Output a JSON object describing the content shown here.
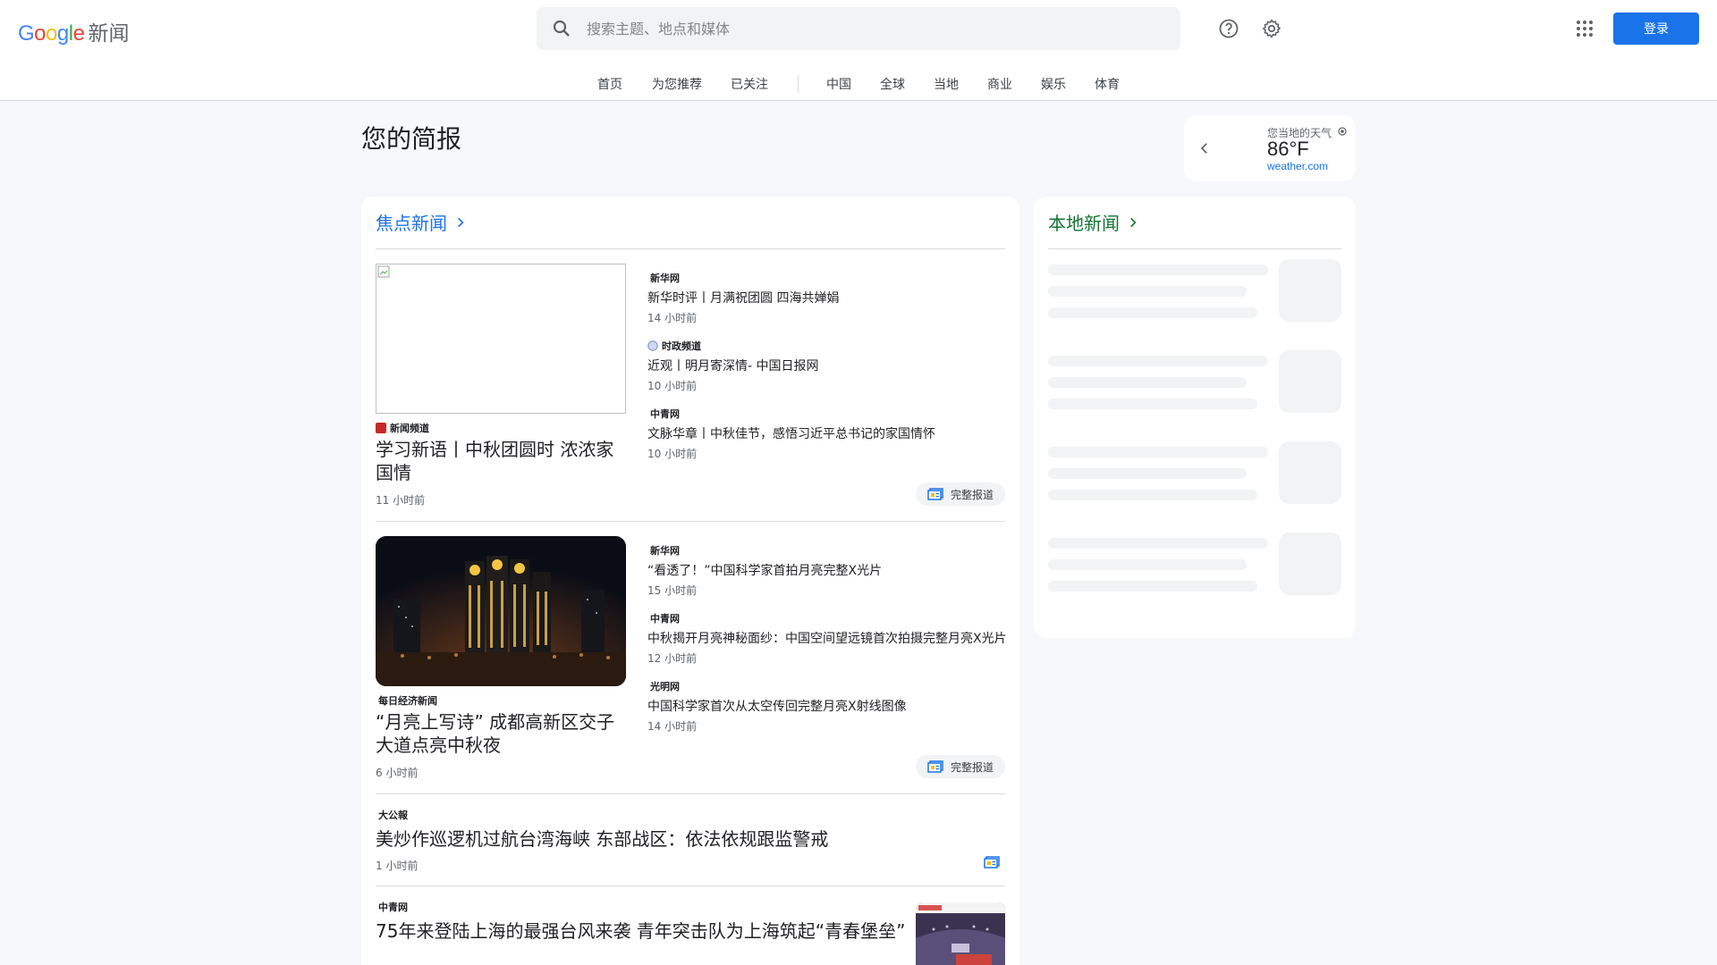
{
  "header": {
    "logo_text": "Google",
    "logo_news": "新闻",
    "search_placeholder": "搜索主题、地点和媒体",
    "signin_label": "登录",
    "icons": [
      "search-icon",
      "help-icon",
      "settings-icon",
      "apps-icon"
    ]
  },
  "nav": {
    "tabs": [
      "首页",
      "为您推荐",
      "已关注",
      "中国",
      "全球",
      "当地",
      "商业",
      "娱乐",
      "体育"
    ]
  },
  "briefing": {
    "title": "您的简报"
  },
  "weather": {
    "label": "您当地的天气",
    "temp": "86°F",
    "source": "weather.com"
  },
  "top_stories": {
    "title": "焦点新闻",
    "full_coverage_label": "完整报道",
    "clusters": [
      {
        "lead": {
          "publisher": "新闻频道",
          "title": "学习新语丨中秋团圆时 浓浓家国情",
          "time": "11 小时前"
        },
        "related": [
          {
            "publisher": "新华网",
            "title": "新华时评丨月满祝团圆 四海共婵娟",
            "time": "14 小时前"
          },
          {
            "publisher": "时政频道",
            "title": "近观丨明月寄深情- 中国日报网",
            "time": "10 小时前"
          },
          {
            "publisher": "中青网",
            "title": "文脉华章丨中秋佳节，感悟习近平总书记的家国情怀",
            "time": "10 小时前"
          }
        ]
      },
      {
        "lead": {
          "publisher": "每日经济新闻",
          "title": "“月亮上写诗” 成都高新区交子大道点亮中秋夜",
          "time": "6 小时前"
        },
        "related": [
          {
            "publisher": "新华网",
            "title": "“看透了！”中国科学家首拍月亮完整X光片",
            "time": "15 小时前"
          },
          {
            "publisher": "中青网",
            "title": "中秋揭开月亮神秘面纱：中国空间望远镜首次拍摄完整月亮X光片",
            "time": "12 小时前"
          },
          {
            "publisher": "光明网",
            "title": "中国科学家首次从太空传回完整月亮X射线图像",
            "time": "14 小时前"
          }
        ]
      }
    ],
    "singles": [
      {
        "publisher": "大公報",
        "title": "美炒作巡逻机过航台湾海峡 东部战区：依法依规跟监警戒",
        "time": "1 小时前"
      },
      {
        "publisher": "中青网",
        "title": "75年来登陆上海的最强台风来袭 青年突击队为上海筑起“青春堡垒”"
      }
    ]
  },
  "local_news": {
    "title": "本地新闻"
  },
  "colors": {
    "accent": "#1a73e8",
    "local_accent": "#137333",
    "background": "#f6f8fc"
  }
}
